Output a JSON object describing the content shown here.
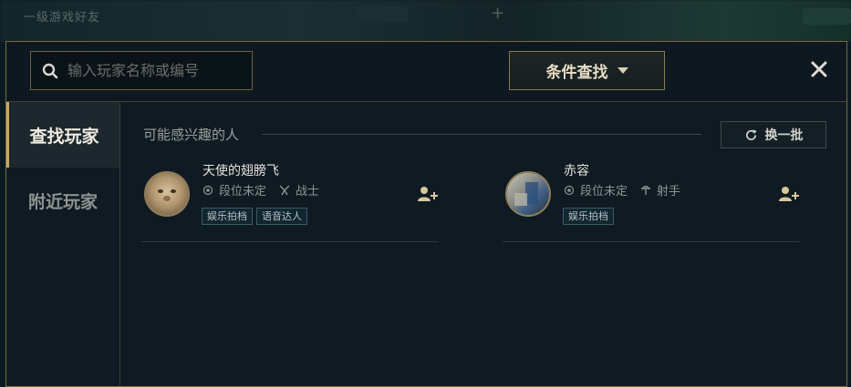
{
  "background": {
    "title": "一级游戏好友"
  },
  "search": {
    "placeholder": "输入玩家名称或编号"
  },
  "filter": {
    "label": "条件查找"
  },
  "sidebar": {
    "items": [
      {
        "label": "查找玩家",
        "active": true
      },
      {
        "label": "附近玩家",
        "active": false
      }
    ]
  },
  "section": {
    "title": "可能感兴趣的人",
    "refresh_label": "换一批"
  },
  "players": [
    {
      "name": "天使的翅膀飞",
      "rank": "段位未定",
      "role": "战士",
      "tags": [
        "娱乐拍档",
        "语音达人"
      ]
    },
    {
      "name": "赤容",
      "rank": "段位未定",
      "role": "射手",
      "tags": [
        "娱乐拍档"
      ]
    }
  ],
  "colors": {
    "accent": "#c8a95c",
    "modal_border": "#7a6a43",
    "background": "#0f1a22"
  }
}
